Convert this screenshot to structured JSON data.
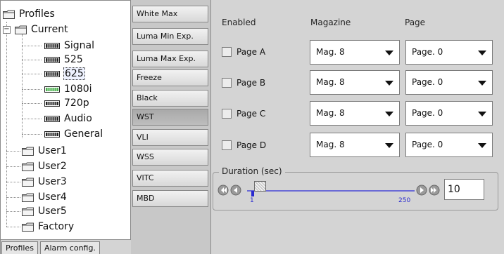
{
  "tree": {
    "root": "Profiles",
    "current": "Current",
    "current_children": [
      "Signal",
      "525",
      "625",
      "1080i",
      "720p",
      "Audio",
      "General"
    ],
    "selected": "625",
    "user_items": [
      "User1",
      "User2",
      "User3",
      "User4",
      "User5",
      "Factory"
    ],
    "expander_symbol": "−"
  },
  "bottom_tabs": [
    "Profiles",
    "Alarm config."
  ],
  "buttons": [
    "White Max",
    "Luma Min Exp.",
    "Luma Max Exp.",
    "Freeze",
    "Black",
    "WST",
    "VLI",
    "WSS",
    "VITC",
    "MBD"
  ],
  "active_button": "WST",
  "headers": {
    "enabled": "Enabled",
    "magazine": "Magazine",
    "page": "Page"
  },
  "rows": [
    {
      "label": "Page A",
      "magazine": "Mag. 8",
      "page": "Page. 0"
    },
    {
      "label": "Page B",
      "magazine": "Mag. 8",
      "page": "Page. 0"
    },
    {
      "label": "Page C",
      "magazine": "Mag. 8",
      "page": "Page. 0"
    },
    {
      "label": "Page D",
      "magazine": "Mag. 8",
      "page": "Page. 0"
    }
  ],
  "duration": {
    "title": "Duration (sec)",
    "min_label": "1",
    "max_label": "250",
    "value": "10"
  },
  "colors": {
    "chip_green": "#4caf50",
    "slider_track": "#6b6bd6",
    "slider_thumb_marker": "#2a2ad0"
  },
  "icons": {
    "folder": "folder-icon",
    "signal_chip": "chip-icon",
    "dropdown": "chevron-down-icon",
    "slider_first": "rewind-icon",
    "slider_prev": "step-back-icon",
    "slider_next": "step-forward-icon",
    "slider_last": "fast-forward-icon"
  }
}
